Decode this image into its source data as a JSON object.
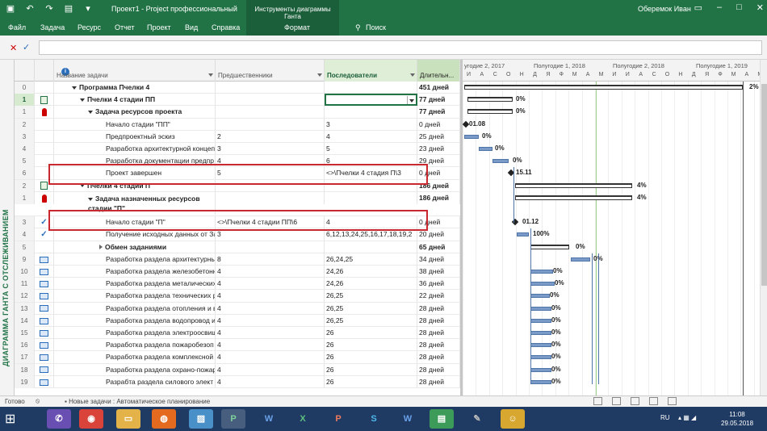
{
  "window": {
    "title": "Проект1 - Project профессиональный",
    "context_tab": "Инструменты диаграммы Ганта",
    "user": "Оберемок Иван"
  },
  "ribbon": {
    "tabs": [
      "Файл",
      "Задача",
      "Ресурс",
      "Отчет",
      "Проект",
      "Вид",
      "Справка",
      "Формат",
      "Поиск"
    ]
  },
  "view_label": "ДИАГРАММА ГАНТА С ОТСЛЕЖИВАНИЕМ",
  "grid": {
    "headers": {
      "name": "Название задачи",
      "predecessors": "Предшественники",
      "successors": "Последователи",
      "duration": "Длительн..."
    },
    "rows": [
      {
        "num": "0",
        "indicator": "",
        "name": "Программа Пчелки 4",
        "pred": "",
        "succ": "",
        "dur": "451 дней"
      },
      {
        "num": "1",
        "indicator": "task",
        "name": "Пчелки 4 стадии ПП",
        "pred": "",
        "succ": "",
        "dur": "77 дней"
      },
      {
        "num": "1",
        "indicator": "res",
        "name": "Задача ресурсов проекта",
        "pred": "",
        "succ": "",
        "dur": "77 дней"
      },
      {
        "num": "2",
        "indicator": "",
        "name": "Начало стадии \"ПП\"",
        "pred": "",
        "succ": "3",
        "dur": "0 дней"
      },
      {
        "num": "3",
        "indicator": "",
        "name": "Предпроектный эскиз",
        "pred": "2",
        "succ": "4",
        "dur": "25 дней"
      },
      {
        "num": "4",
        "indicator": "",
        "name": "Разработка архитектурной концеп",
        "pred": "3",
        "succ": "5",
        "dur": "23 дней"
      },
      {
        "num": "5",
        "indicator": "",
        "name": "Разработка документации предпр",
        "pred": "4",
        "succ": "6",
        "dur": "29 дней"
      },
      {
        "num": "6",
        "indicator": "",
        "name": "Проект завершен",
        "pred": "5",
        "succ": "<>\\Пчелки 4 стадия П\\3",
        "dur": "0 дней"
      },
      {
        "num": "2",
        "indicator": "task",
        "name": "Пчелки 4 стадии П",
        "pred": "",
        "succ": "",
        "dur": "186 дней"
      },
      {
        "num": "1",
        "indicator": "res",
        "name": "Задача назначенных ресурсов стадии \"П\"",
        "pred": "",
        "succ": "",
        "dur": "186 дней"
      },
      {
        "num": "3",
        "indicator": "check",
        "name": "Начало стадии \"П\"",
        "pred": "<>\\Пчелки 4 стадии ПП\\6",
        "succ": "4",
        "dur": "0 дней"
      },
      {
        "num": "4",
        "indicator": "check",
        "name": "Получение исходных данных от За",
        "pred": "3",
        "succ": "6,12,13,24,25,16,17,18,19,2",
        "dur": "20 дней"
      },
      {
        "num": "5",
        "indicator": "",
        "name": "Обмен заданиями",
        "pred": "",
        "succ": "",
        "dur": "65 дней"
      },
      {
        "num": "9",
        "indicator": "cal",
        "name": "Разработка раздела архитектурны",
        "pred": "8",
        "succ": "26,24,25",
        "dur": "34 дней"
      },
      {
        "num": "10",
        "indicator": "cal",
        "name": "Разработка раздела железобетонн",
        "pred": "4",
        "succ": "24,26",
        "dur": "38 дней"
      },
      {
        "num": "11",
        "indicator": "cal",
        "name": "Разработка раздела металических",
        "pred": "4",
        "succ": "24,26",
        "dur": "36 дней"
      },
      {
        "num": "12",
        "indicator": "cal",
        "name": "Разработка раздела технических р",
        "pred": "4",
        "succ": "26,25",
        "dur": "22 дней"
      },
      {
        "num": "13",
        "indicator": "cal",
        "name": "Разработка раздела отопления и в",
        "pred": "4",
        "succ": "26,25",
        "dur": "28 дней"
      },
      {
        "num": "14",
        "indicator": "cal",
        "name": "Разработка раздела водопровод и",
        "pred": "4",
        "succ": "26,25",
        "dur": "28 дней"
      },
      {
        "num": "15",
        "indicator": "cal",
        "name": "Разработка раздела электроосвищ",
        "pred": "4",
        "succ": "26",
        "dur": "28 дней"
      },
      {
        "num": "16",
        "indicator": "cal",
        "name": "Разработка раздела пожаробезоп",
        "pred": "4",
        "succ": "26",
        "dur": "28 дней"
      },
      {
        "num": "17",
        "indicator": "cal",
        "name": "Разработка раздела комплексной",
        "pred": "4",
        "succ": "26",
        "dur": "28 дней"
      },
      {
        "num": "18",
        "indicator": "cal",
        "name": "Разработка раздела охрано-пожар",
        "pred": "4",
        "succ": "26",
        "dur": "28 дней"
      },
      {
        "num": "19",
        "indicator": "cal",
        "name": "Разрабта раздела силового элект",
        "pred": "4",
        "succ": "26",
        "dur": "28 дней"
      }
    ]
  },
  "timeline": {
    "periods": [
      "угодие 2, 2017",
      "Полугодие 1, 2018",
      "Полугодие 2, 2018",
      "Полугодие 1, 2019"
    ],
    "months": [
      "И",
      "А",
      "С",
      "О",
      "Н",
      "Д",
      "Я",
      "Ф",
      "М",
      "А",
      "М",
      "И",
      "И",
      "А",
      "С",
      "О",
      "Н",
      "Д",
      "Я",
      "Ф",
      "М",
      "А",
      "М"
    ],
    "bar_labels": {
      "r0": "2%",
      "r1": "0%",
      "r2": "0%",
      "r3": "01.08",
      "r4": "0%",
      "r5": "0%",
      "r6": "0%",
      "r7": "15.11",
      "r8": "4%",
      "r9": "4%",
      "r10": "01.12",
      "r11": "100%",
      "r12": "0%",
      "r13": "0%",
      "r14": "0%",
      "r15": "0%",
      "r16": "0%",
      "r17": "0%",
      "r18": "0%",
      "r19": "0%",
      "r20": "0%",
      "r21": "0%",
      "r22": "0%",
      "r23": "0%"
    }
  },
  "status": {
    "ready": "Готово",
    "mode": "Новые задачи : Автоматическое планирование"
  },
  "taskbar": {
    "lang": "RU",
    "time": "11:08",
    "date": "29.05.2018"
  }
}
